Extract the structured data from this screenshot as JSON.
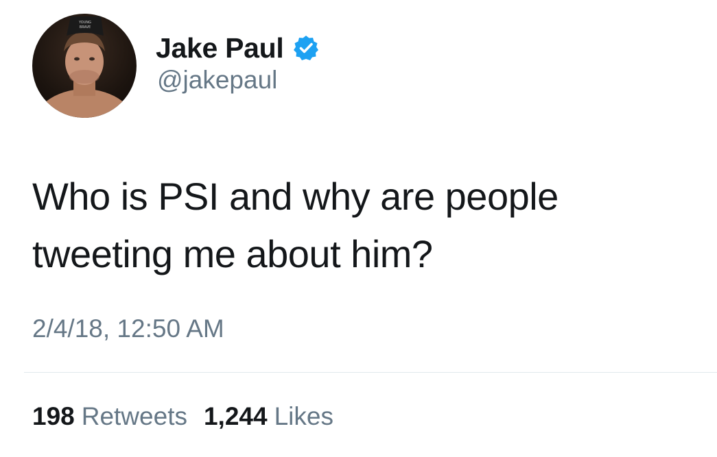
{
  "user": {
    "display_name": "Jake Paul",
    "handle": "@jakepaul",
    "verified": true,
    "avatar_icon": "profile-photo",
    "hat_text": "YOUNG BRAVE"
  },
  "tweet": {
    "text": "Who is PSI and why are people tweeting me about him?",
    "timestamp": "2/4/18, 12:50 AM"
  },
  "stats": {
    "retweets_count": "198",
    "retweets_label": "Retweets",
    "likes_count": "1,244",
    "likes_label": "Likes"
  },
  "colors": {
    "text_primary": "#14171a",
    "text_secondary": "#657786",
    "verified_blue": "#1da1f2",
    "divider": "#e1e8ed"
  }
}
